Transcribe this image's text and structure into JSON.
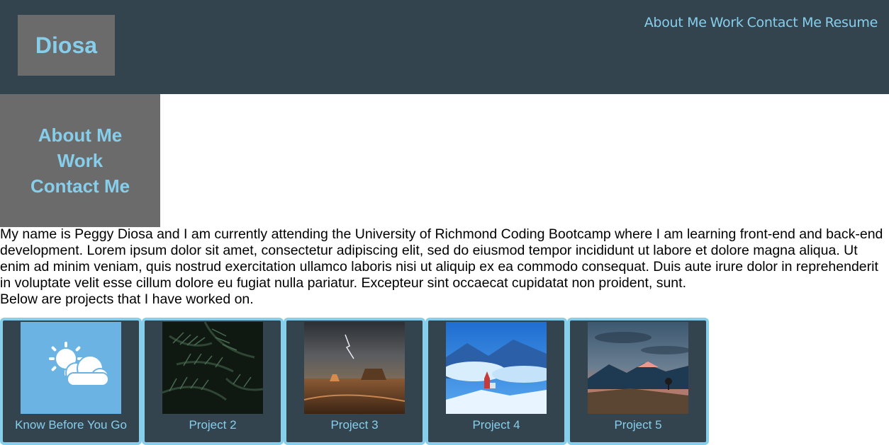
{
  "header": {
    "logo": "Diosa",
    "nav": [
      "About Me",
      "Work",
      "Contact Me",
      "Resume"
    ]
  },
  "sidebar": {
    "items": [
      "About Me",
      "Work",
      "Contact Me"
    ]
  },
  "bio": {
    "paragraph": "My name is Peggy Diosa and I am currently attending the University of Richmond Coding Bootcamp where I am learning front-end and back-end development. Lorem ipsum dolor sit amet, consectetur adipiscing elit, sed do eiusmod tempor incididunt ut labore et dolore magna aliqua. Ut enim ad minim veniam, quis nostrud exercitation ullamco laboris nisi ut aliquip ex ea commodo consequat. Duis aute irure dolor in reprehenderit in voluptate velit esse cillum dolore eu fugiat nulla pariatur. Excepteur sint occaecat cupidatat non proident, sunt.",
    "intro": "Below are projects that I have worked on."
  },
  "projects": [
    {
      "label": "Know Before You Go",
      "image": "weather-sun-cloud-icon"
    },
    {
      "label": "Project 2",
      "image": "palm-leaves-photo"
    },
    {
      "label": "Project 3",
      "image": "desert-lightning-photo"
    },
    {
      "label": "Project 4",
      "image": "snowy-mountain-chapel-photo"
    },
    {
      "label": "Project 5",
      "image": "mountain-sunset-photo"
    }
  ],
  "colors": {
    "header_bg": "#34444f",
    "accent": "#87ceeb",
    "box_gray": "#6b6b6b"
  }
}
